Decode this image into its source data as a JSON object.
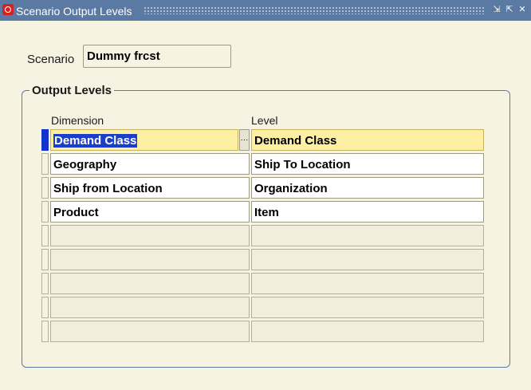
{
  "window": {
    "title": "Scenario Output Levels",
    "min_glyph": "⇲",
    "max_glyph": "⇱",
    "close_glyph": "✕"
  },
  "scenario": {
    "label": "Scenario",
    "value": "Dummy frcst"
  },
  "output_levels": {
    "legend": "Output Levels",
    "columns": {
      "dimension": "Dimension",
      "level": "Level"
    },
    "rows": [
      {
        "dimension": "Demand Class",
        "level": "Demand Class"
      },
      {
        "dimension": "Geography",
        "level": "Ship To Location"
      },
      {
        "dimension": "Ship from Location",
        "level": "Organization"
      },
      {
        "dimension": "Product",
        "level": "Item"
      },
      {
        "dimension": "",
        "level": ""
      },
      {
        "dimension": "",
        "level": ""
      },
      {
        "dimension": "",
        "level": ""
      },
      {
        "dimension": "",
        "level": ""
      },
      {
        "dimension": "",
        "level": ""
      }
    ],
    "lov_glyph": "···"
  },
  "colors": {
    "titlebar": "#5b7aa3",
    "background": "#f7f3e3",
    "active_row": "#fdf0a4",
    "selection": "#1a3dcc"
  }
}
